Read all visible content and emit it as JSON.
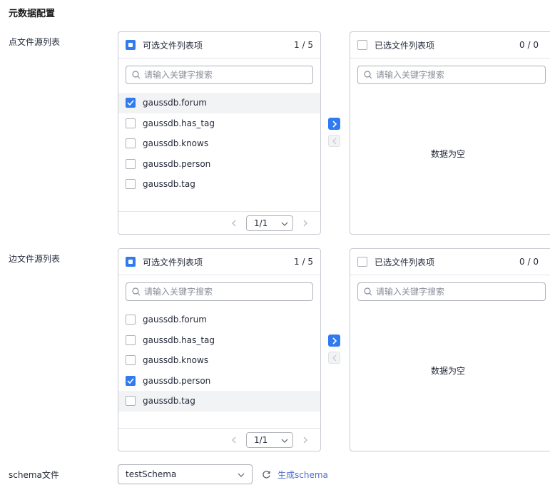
{
  "section_title": "元数据配置",
  "vertex": {
    "label": "点文件源列表",
    "source": {
      "title": "可选文件列表项",
      "count": "1 / 5",
      "search_placeholder": "请输入关键字搜索",
      "items": [
        {
          "label": "gaussdb.forum",
          "checked": true,
          "highlighted": true
        },
        {
          "label": "gaussdb.has_tag",
          "checked": false,
          "highlighted": false
        },
        {
          "label": "gaussdb.knows",
          "checked": false,
          "highlighted": false
        },
        {
          "label": "gaussdb.person",
          "checked": false,
          "highlighted": false
        },
        {
          "label": "gaussdb.tag",
          "checked": false,
          "highlighted": false
        }
      ],
      "page": "1/1"
    },
    "target": {
      "title": "已选文件列表项",
      "count": "0 / 0",
      "search_placeholder": "请输入关键字搜索",
      "empty_text": "数据为空"
    }
  },
  "edge": {
    "label": "边文件源列表",
    "source": {
      "title": "可选文件列表项",
      "count": "1 / 5",
      "search_placeholder": "请输入关键字搜索",
      "items": [
        {
          "label": "gaussdb.forum",
          "checked": false,
          "highlighted": false
        },
        {
          "label": "gaussdb.has_tag",
          "checked": false,
          "highlighted": false
        },
        {
          "label": "gaussdb.knows",
          "checked": false,
          "highlighted": false
        },
        {
          "label": "gaussdb.person",
          "checked": true,
          "highlighted": false
        },
        {
          "label": "gaussdb.tag",
          "checked": false,
          "highlighted": true
        }
      ],
      "page": "1/1"
    },
    "target": {
      "title": "已选文件列表项",
      "count": "0 / 0",
      "search_placeholder": "请输入关键字搜索",
      "empty_text": "数据为空"
    }
  },
  "schema": {
    "label": "schema文件",
    "selected": "testSchema",
    "generate_label": "生成schema"
  },
  "colors": {
    "primary": "#2f7bef",
    "link": "#526ecc",
    "border": "#adb0b8",
    "highlight_row": "#f2f3f5"
  }
}
